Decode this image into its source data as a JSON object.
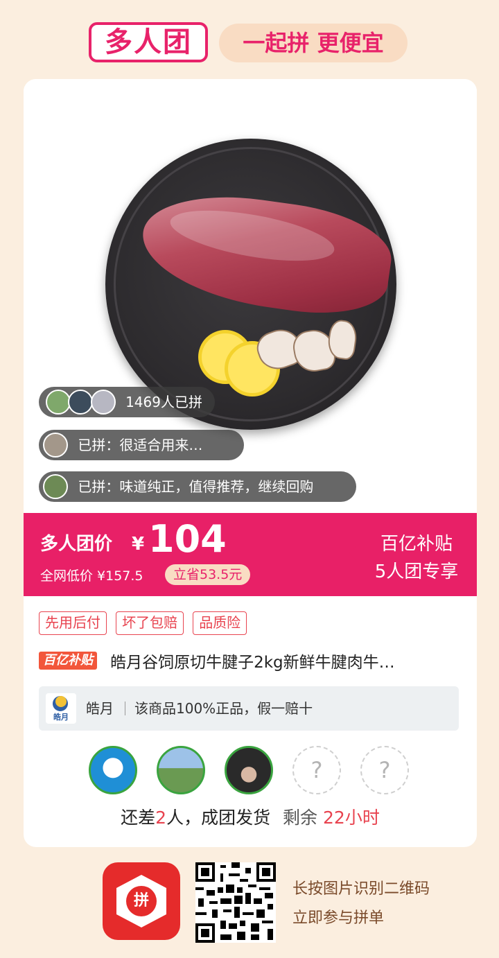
{
  "header": {
    "brand": "多人团",
    "slogan": "一起拼 更便宜"
  },
  "social": {
    "joined_count": "1469人已拼",
    "comments": [
      "已拼：很适合用来…",
      "已拼：味道纯正，值得推荐，继续回购"
    ]
  },
  "price": {
    "group_label": "多人团价",
    "currency": "¥",
    "amount": "104",
    "market_label": "全网低价 ¥157.5",
    "save_label": "立省53.5元",
    "subsidy_line1": "百亿补贴",
    "subsidy_line2": "5人团专享"
  },
  "tags": [
    "先用后付",
    "坏了包赔",
    "品质险"
  ],
  "product": {
    "badge": "百亿补贴",
    "title": "皓月谷饲原切牛腱子2kg新鲜牛腱肉牛…"
  },
  "shop": {
    "logo_text": "皓月",
    "name": "皓月",
    "promise": "该商品100%正品，假一赔十"
  },
  "group": {
    "slots_empty_glyph": "?",
    "status_prefix": "还差",
    "missing": "2",
    "status_suffix": "人，成团发货",
    "remaining_label": "剩余",
    "remaining_time": "22小时"
  },
  "footer": {
    "app_icon_text": "拼",
    "hint1": "长按图片识别二维码",
    "hint2": "立即参与拼单"
  },
  "colors": {
    "accent": "#e82067",
    "background": "#fbeedf",
    "tag_red": "#e8434f"
  }
}
